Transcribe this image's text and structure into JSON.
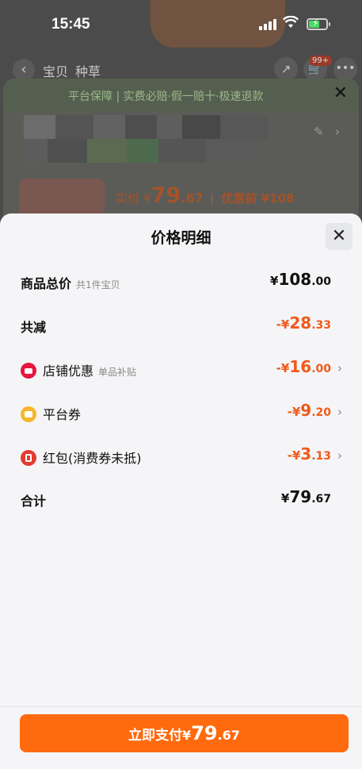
{
  "status_bar": {
    "time": "15:45"
  },
  "background_page": {
    "nav_tabs": [
      "宝贝",
      "种草"
    ],
    "cart_badge": "99+",
    "guarantee_text": "平台保障 | 实费必赔·假一赔十·极速退款",
    "price_label": "实付",
    "price_currency": "¥",
    "price_int": "79",
    "price_dec": ".67",
    "original_price": "优惠前 ¥108"
  },
  "modal": {
    "title": "价格明细",
    "rows": [
      {
        "label": "商品总价",
        "sub": "共1件宝贝",
        "cur": "¥",
        "int": "108",
        "dec": ".00"
      },
      {
        "label": "共减",
        "cur": "-¥",
        "int": "28",
        "dec": ".33"
      },
      {
        "label": "店铺优惠",
        "sub": "单品补贴",
        "icon": "shop-icon",
        "cur": "-¥",
        "int": "16",
        "dec": ".00"
      },
      {
        "label": "平台券",
        "icon": "coupon-icon",
        "cur": "-¥",
        "int": "9",
        "dec": ".20"
      },
      {
        "label": "红包(消费券未抵)",
        "icon": "red-packet-icon",
        "cur": "-¥",
        "int": "3",
        "dec": ".13"
      },
      {
        "label": "合计",
        "cur": "¥",
        "int": "79",
        "dec": ".67"
      }
    ],
    "pay_button": {
      "label": "立即支付",
      "cur": "¥",
      "int": "79",
      "dec": ".67"
    }
  },
  "colors": {
    "accent": "#ff6a0e",
    "minus": "#f05a1a"
  }
}
